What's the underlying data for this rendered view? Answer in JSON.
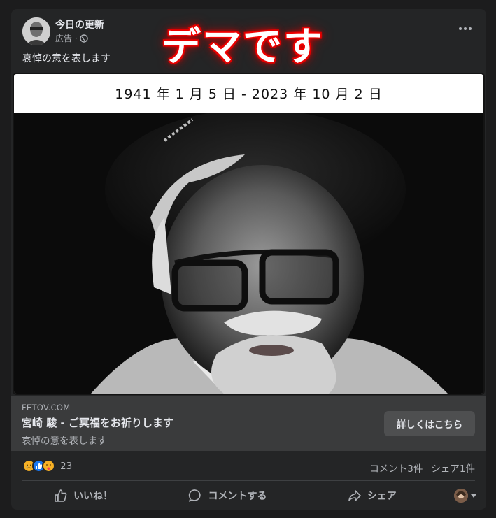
{
  "post": {
    "page_name": "今日の更新",
    "sponsored_label": "広告 ·",
    "caption": "哀悼の意を表します",
    "overlay_text": "デマです",
    "date_range": "1941 年 1 月 5 日  -  2023 年 10 月 2 日"
  },
  "link_preview": {
    "domain": "FETOV.COM",
    "title": "宮崎 駿 - ご冥福をお祈りします",
    "subtitle": "哀悼の意を表します",
    "cta_label": "詳しくはこちら"
  },
  "stats": {
    "reaction_count": "23",
    "reactions": [
      "sad-reaction",
      "like-reaction",
      "care-reaction"
    ],
    "comments": "コメント3件",
    "shares": "シェア1件"
  },
  "actions": {
    "like": "いいね！",
    "comment": "コメントする",
    "share": "シェア"
  },
  "icons": {
    "globe": "globe-icon",
    "more": "more-icon",
    "like": "thumbs-up-icon",
    "comment": "comment-bubble-icon",
    "share": "share-arrow-icon"
  },
  "colors": {
    "card_bg": "#242526",
    "link_bg": "#3a3b3c",
    "text_primary": "#e4e6eb",
    "text_secondary": "#b0b3b8",
    "overlay_glow": "#ff0000"
  }
}
